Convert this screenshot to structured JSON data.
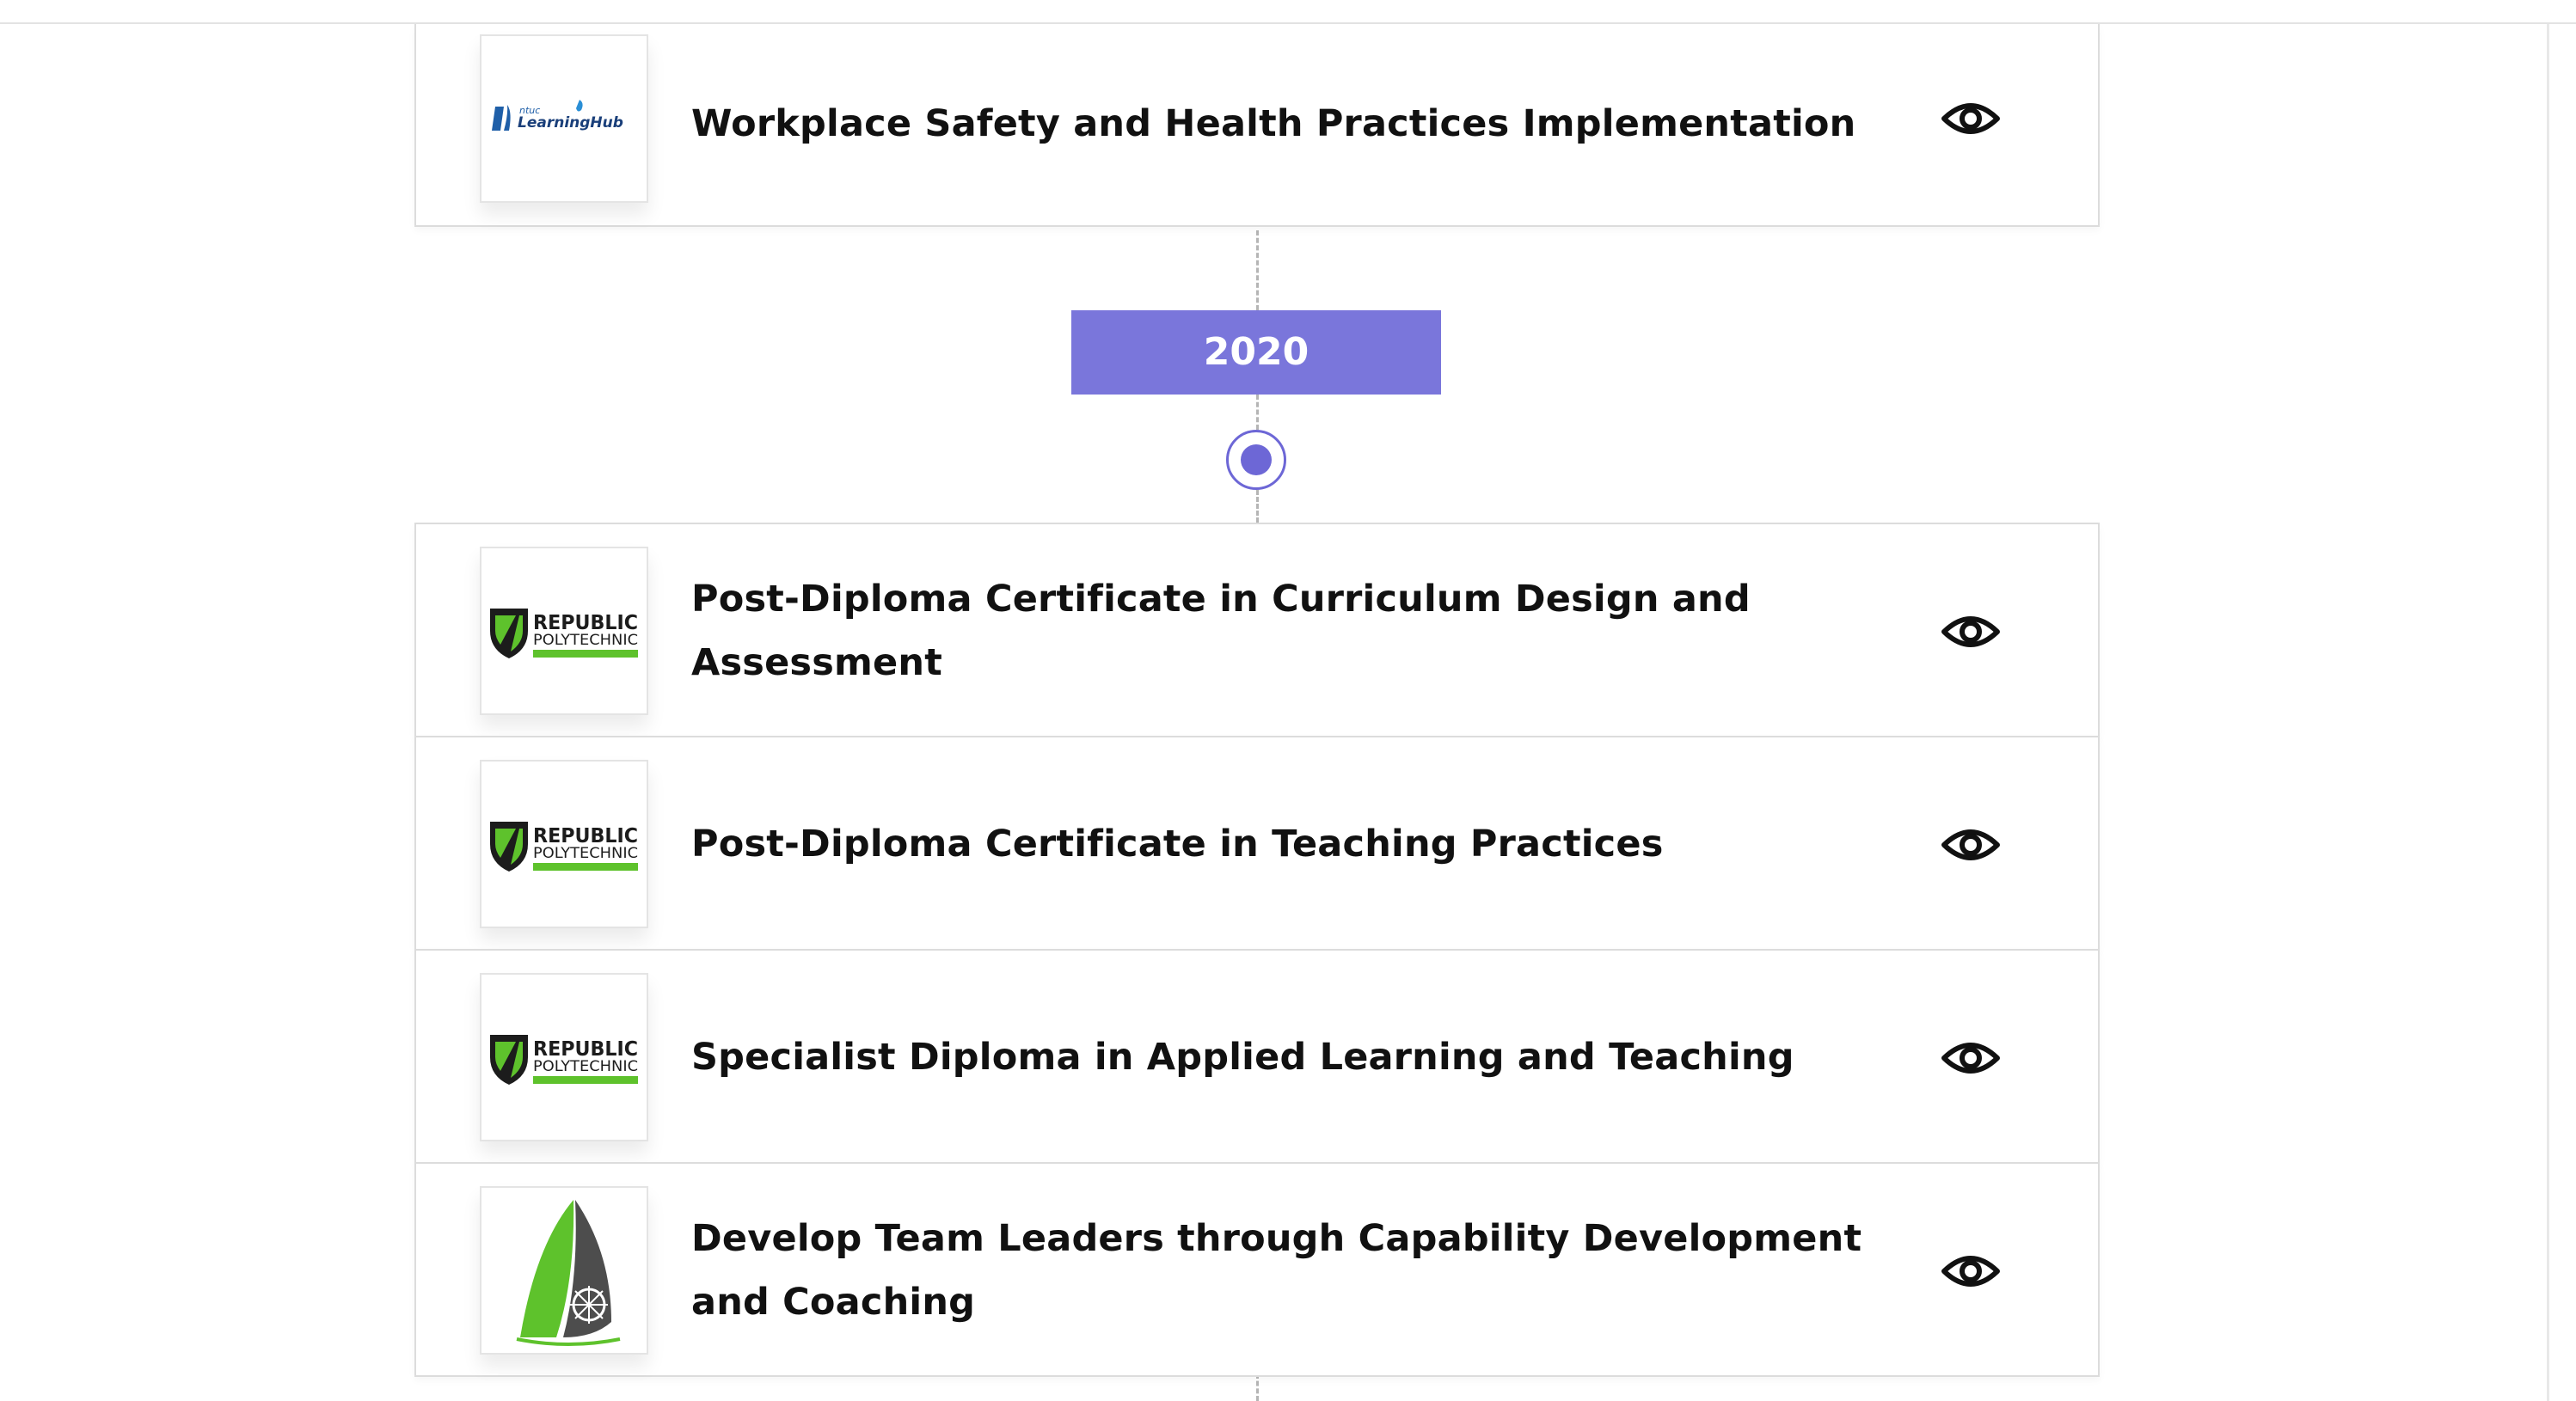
{
  "timeline": {
    "year": "2020",
    "items": [
      {
        "title": "Workplace Safety and Health Practices Implementation",
        "logo": "ntuc-learninghub-logo",
        "logo_text": "ntuc LearningHub"
      },
      {
        "title": "Post-Diploma Certificate in Curriculum Design and Assessment",
        "logo": "republic-polytechnic-logo",
        "logo_text": "REPUBLIC POLYTECHNIC"
      },
      {
        "title": "Post-Diploma Certificate in Teaching Practices",
        "logo": "republic-polytechnic-logo",
        "logo_text": "REPUBLIC POLYTECHNIC"
      },
      {
        "title": "Specialist Diploma in Applied Learning and Teaching",
        "logo": "republic-polytechnic-logo",
        "logo_text": "REPUBLIC POLYTECHNIC"
      },
      {
        "title": "Develop Team Leaders through Capability Development and Coaching",
        "logo": "sail-logo"
      }
    ],
    "view_icon": "eye-icon"
  },
  "colors": {
    "accent": "#7a76db",
    "republic_green": "#5ec22c",
    "text": "#111111",
    "border": "#dcdcdc"
  }
}
